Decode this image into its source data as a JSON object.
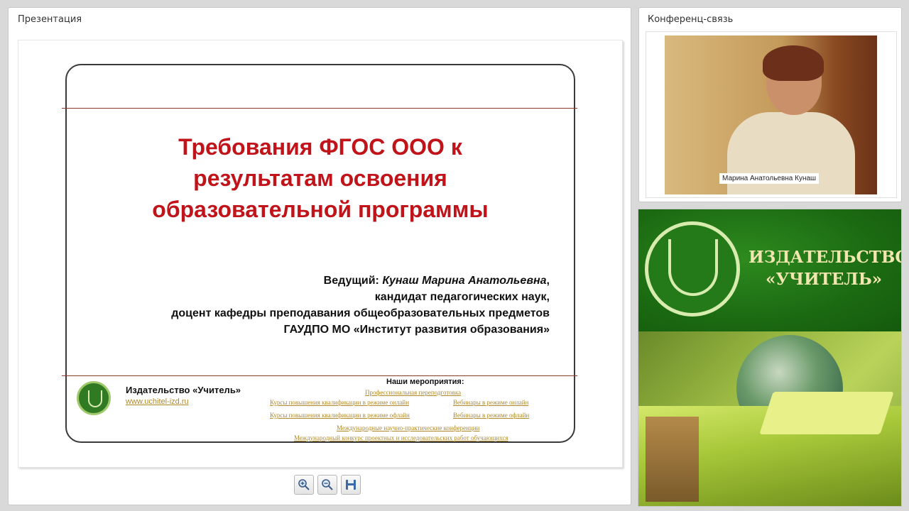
{
  "presentation_panel": {
    "title": "Презентация",
    "slide": {
      "title_lines": [
        "Требования ФГОС ООО к",
        "результатам освоения",
        "образовательной программы"
      ],
      "presenter_label": "Ведущий:",
      "presenter_name": "Кунаш Марина Анатольевна",
      "presenter_lines": [
        "кандидат педагогических наук,",
        "доцент кафедры преподавания общеобразовательных предметов",
        "ГАУДПО МО «Институт развития образования»"
      ],
      "publisher_name": "Издательство «Учитель»",
      "publisher_site": "www.uchitel-izd.ru",
      "events_title": "Наши мероприятия",
      "events": [
        "Профессиональная переподготовка",
        "Курсы повышения квалификации в режиме онлайн",
        "Вебинары в режиме онлайн",
        "Курсы повышения квалификации в режиме офлайн",
        "Вебинары в режиме офлайн",
        "Международные научно-практические конференции",
        "Международный конкурс проектных и исследовательских работ обучающихся"
      ]
    },
    "toolbar": {
      "zoom_in_icon": "zoom-in-icon",
      "zoom_out_icon": "zoom-out-icon",
      "save_icon": "save-icon"
    }
  },
  "conference_panel": {
    "title": "Конференц-связь",
    "participant_name": "Марина Анатольевна Кунаш"
  },
  "banner": {
    "line1": "ИЗДАТЕЛЬСТВО",
    "line2": "«УЧИТЕЛЬ»"
  },
  "colors": {
    "title_red": "#c0141a",
    "banner_green": "#1b6a12",
    "link_gold": "#b08a2a"
  }
}
